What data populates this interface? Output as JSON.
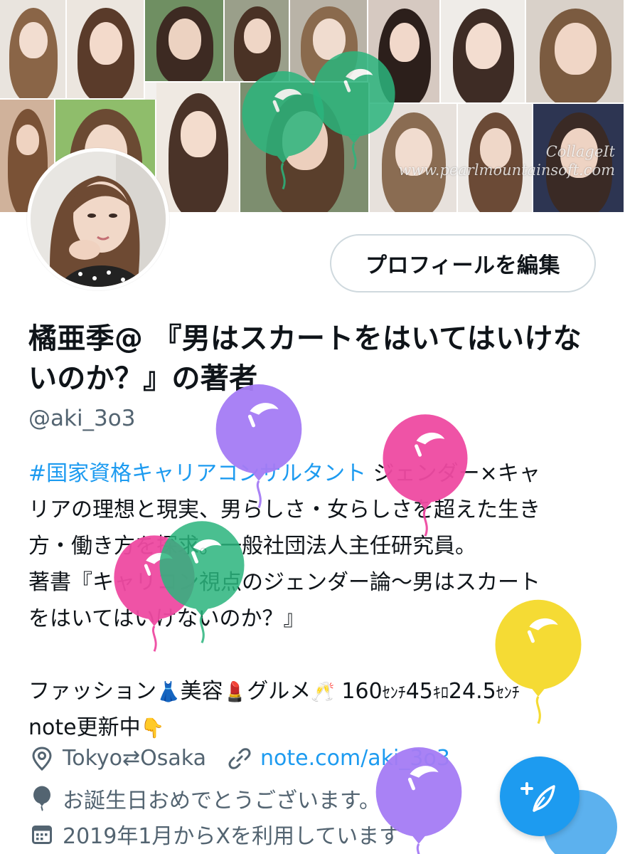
{
  "banner": {
    "watermark_line1": "CollageIt",
    "watermark_line2": "www.pearlmountainsoft.com"
  },
  "profile": {
    "edit_button_label": "プロフィールを編集",
    "display_name": "橘亜季@ 『男はスカートをはいてはいけないのか？』の著者",
    "handle": "@aki_3o3"
  },
  "bio": {
    "hashtag": "#国家資格キャリアコンサルタント",
    "line1_rest": " ジェンダー×キャ",
    "line2": "リアの理想と現実、男らしさ・女らしさを超えた生き",
    "line3": "方・働き方を探求。一般社団法人主任研究員。",
    "line4": "著書『キャリコン視点のジェンダー論〜男はスカート",
    "line5": "をはいてはいけないのか？』",
    "line6_fashion": "ファッション",
    "line6_beauty": "美容",
    "line6_gourmet": "グルメ",
    "line6_height": "160",
    "line6_height_unit": "ｾﾝﾁ",
    "line6_weight": "45",
    "line6_weight_unit": "ｷﾛ",
    "line6_foot": "24.5",
    "line6_foot_unit": "ｾﾝﾁ",
    "line7": "note更新中",
    "emoji_dress": "👗",
    "emoji_lipstick": "💄",
    "emoji_cheers": "🥂",
    "emoji_point": "👇"
  },
  "meta": {
    "location": "Tokyo⇄Osaka",
    "link": "note.com/aki_3o3",
    "birthday": "お誕生日おめでとうございます。",
    "joined": "2019年1月からXを利用しています"
  },
  "icons": {
    "location": "location-pin-icon",
    "link": "link-icon",
    "birthday": "balloon-icon",
    "joined": "calendar-icon",
    "compose": "compose-icon"
  },
  "colors": {
    "link_blue": "#1d9bf0",
    "secondary_text": "#536471",
    "balloon_green": "#2bb57d",
    "balloon_purple": "#a57cf5",
    "balloon_pink": "#ef4aa2",
    "balloon_yellow": "#f5d923"
  }
}
